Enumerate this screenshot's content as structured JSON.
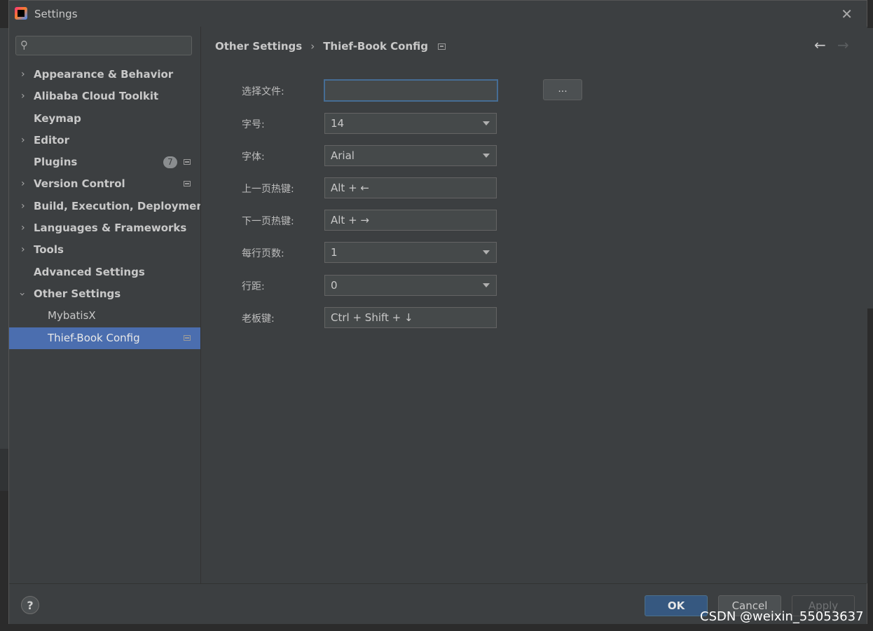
{
  "window": {
    "title": "Settings",
    "close_glyph": "✕"
  },
  "sidebar": {
    "search_placeholder": "",
    "items": [
      {
        "label": "Appearance & Behavior",
        "expandable": true
      },
      {
        "label": "Alibaba Cloud Toolkit",
        "expandable": true
      },
      {
        "label": "Keymap",
        "expandable": false
      },
      {
        "label": "Editor",
        "expandable": true
      },
      {
        "label": "Plugins",
        "expandable": false,
        "badge": "7"
      },
      {
        "label": "Version Control",
        "expandable": true
      },
      {
        "label": "Build, Execution, Deployment",
        "expandable": true
      },
      {
        "label": "Languages & Frameworks",
        "expandable": true
      },
      {
        "label": "Tools",
        "expandable": true
      },
      {
        "label": "Advanced Settings",
        "expandable": false
      },
      {
        "label": "Other Settings",
        "expandable": true,
        "expanded": true
      },
      {
        "label": "MybatisX",
        "child": true
      },
      {
        "label": "Thief-Book Config",
        "child": true,
        "selected": true
      }
    ]
  },
  "breadcrumb": {
    "parent": "Other Settings",
    "current": "Thief-Book Config"
  },
  "nav": {
    "back": "←",
    "forward": "→"
  },
  "form": {
    "file_label": "选择文件:",
    "file_value": "",
    "browse_label": "...",
    "font_size_label": "字号:",
    "font_size_value": "14",
    "font_label": "字体:",
    "font_value": "Arial",
    "prev_label": "上一页热键:",
    "prev_value": "Alt + ←",
    "next_label": "下一页热键:",
    "next_value": "Alt + →",
    "pages_label": "每行页数:",
    "pages_value": "1",
    "spacing_label": "行距:",
    "spacing_value": "0",
    "boss_label": "老板键:",
    "boss_value": "Ctrl + Shift + ↓"
  },
  "footer": {
    "help": "?",
    "ok": "OK",
    "cancel": "Cancel",
    "apply": "Apply"
  },
  "watermark": "CSDN @weixin_55053637",
  "colors": {
    "selection": "#4b6eaf",
    "ok_button": "#365880",
    "panel": "#3c3f41"
  }
}
